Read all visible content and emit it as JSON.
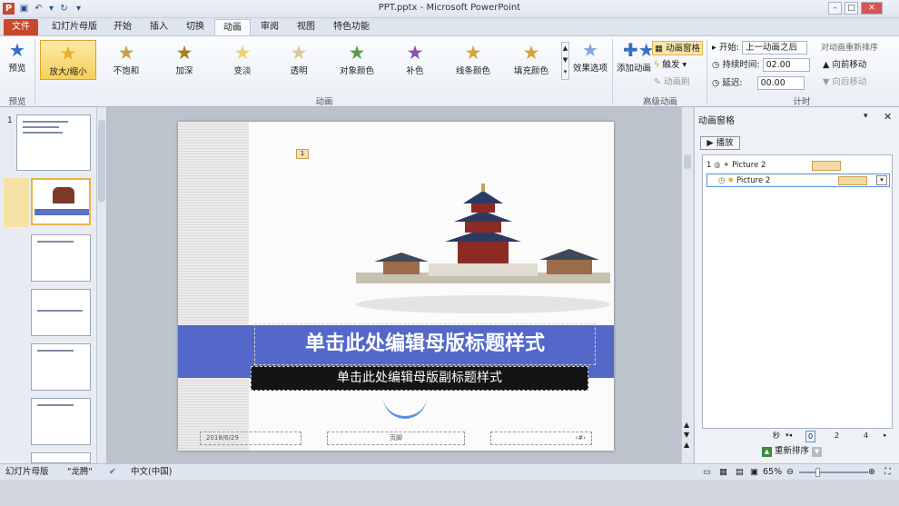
{
  "window": {
    "title": "PPT.pptx - Microsoft PowerPoint"
  },
  "tabs": [
    "文件",
    "幻灯片母版",
    "开始",
    "插入",
    "切换",
    "动画",
    "审阅",
    "视图",
    "特色功能"
  ],
  "ribbon": {
    "preview": "预览",
    "animations": [
      "放大/缩小",
      "不饱和",
      "加深",
      "变淡",
      "透明",
      "对象颜色",
      "补色",
      "线条颜色",
      "填充颜色"
    ],
    "effect_options": "效果选项",
    "add_animation": "添加动画",
    "anim_pane": "动画窗格",
    "trigger": "触发",
    "anim_painter": "动画刷",
    "start_label": "开始:",
    "start_value": "上一动画之后",
    "duration_label": "持续时间:",
    "duration_value": "02.00",
    "delay_label": "延迟:",
    "delay_value": "00.00",
    "reorder": "对动画重新排序",
    "move_earlier": "向前移动",
    "move_later": "向后移动",
    "groups": {
      "preview": "预览",
      "animation": "动画",
      "advanced": "高级动画",
      "timing": "计时"
    }
  },
  "slides": {
    "first_number": "1"
  },
  "slide": {
    "title": "单击此处编辑母版标题样式",
    "subtitle": "单击此处编辑母版副标题样式",
    "date": "2018/6/29",
    "footer": "页脚",
    "pagenum": "‹#›",
    "tag": "1"
  },
  "anim_pane": {
    "title": "动画窗格",
    "play": "播放",
    "items": [
      {
        "num": "1",
        "name": "Picture 2"
      },
      {
        "num": "",
        "name": "Picture 2"
      }
    ],
    "seconds_label": "秒",
    "ticks": [
      "0",
      "2",
      "4"
    ],
    "reorder_label": "重新排序"
  },
  "status": {
    "view": "幻灯片母版",
    "theme": "\"龙腾\"",
    "lang": "中文(中国)",
    "zoom": "65%"
  },
  "colors": {
    "band": "#5468c9",
    "file_tab": "#c8482c",
    "selected": "#f8cf5a"
  }
}
